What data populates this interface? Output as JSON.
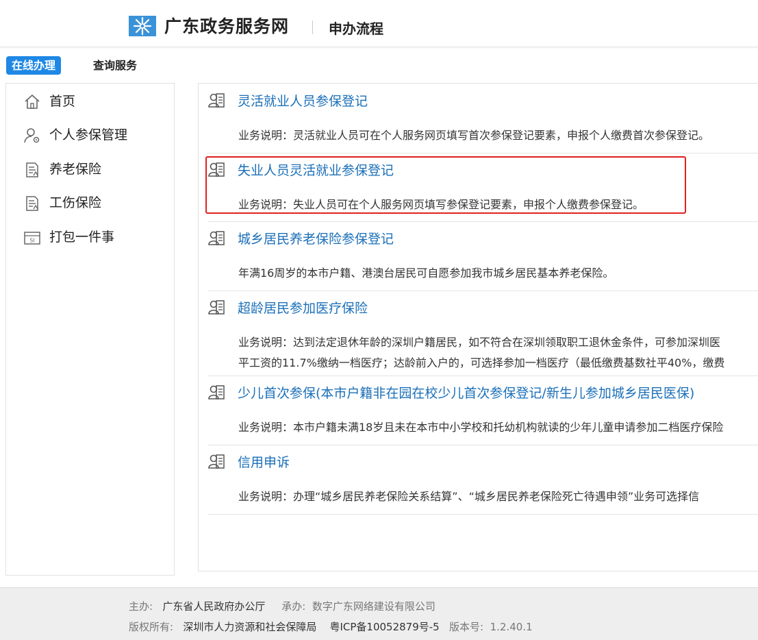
{
  "header": {
    "brand_title": "广东政务服务网",
    "page_title": "申办流程"
  },
  "tabs": [
    {
      "label": "在线办理",
      "active": true
    },
    {
      "label": "查询服务",
      "active": false
    }
  ],
  "sidebar": {
    "items": [
      {
        "label": "首页",
        "icon": "home-icon"
      },
      {
        "label": "个人参保管理",
        "icon": "user-gear-icon"
      },
      {
        "label": "养老保险",
        "icon": "document-icon"
      },
      {
        "label": "工伤保险",
        "icon": "document-icon"
      },
      {
        "label": "打包一件事",
        "icon": "si-card-icon"
      }
    ]
  },
  "services": [
    {
      "title": "灵活就业人员参保登记",
      "desc": "业务说明：灵活就业人员可在个人服务网页填写首次参保登记要素，申报个人缴费首次参保登记。"
    },
    {
      "title": "失业人员灵活就业参保登记",
      "desc": "业务说明：失业人员可在个人服务网页填写参保登记要素，申报个人缴费参保登记。",
      "highlighted": true
    },
    {
      "title": "城乡居民养老保险参保登记",
      "desc": "年满16周岁的本市户籍、港澳台居民可自愿参加我市城乡居民基本养老保险。"
    },
    {
      "title": "超龄居民参加医疗保险",
      "desc": "业务说明：达到法定退休年龄的深圳户籍居民，如不符合在深圳领取职工退休金条件，可参加深圳医",
      "desc2": "平工资的11.7%缴纳一档医疗；达龄前入户的，可选择参加一档医疗（最低缴费基数社平40%，缴费"
    },
    {
      "title": "少儿首次参保(本市户籍非在园在校少儿首次参保登记/新生儿参加城乡居民医保)",
      "desc": "业务说明：本市户籍未满18岁且未在本市中小学校和托幼机构就读的少年儿童申请参加二档医疗保险"
    },
    {
      "title": "信用申诉",
      "desc": "业务说明：办理“城乡居民养老保险关系结算”、“城乡居民养老保险死亡待遇申领”业务可选择信"
    }
  ],
  "footer": {
    "host_label": "主办:",
    "host_value": "广东省人民政府办公厅",
    "organizer_label": "承办:",
    "organizer_value": "数字广东网络建设有限公司",
    "copyright_label": "版权所有:",
    "copyright_value": "深圳市人力资源和社会保障局",
    "icp": "粤ICP备10052879号-5",
    "version_label": "版本号:",
    "version_value": "1.2.40.1"
  },
  "colors": {
    "accent": "#1e88e5",
    "link": "#1a6fb8",
    "highlight_border": "#e02020",
    "logo": "#3a93d8"
  }
}
